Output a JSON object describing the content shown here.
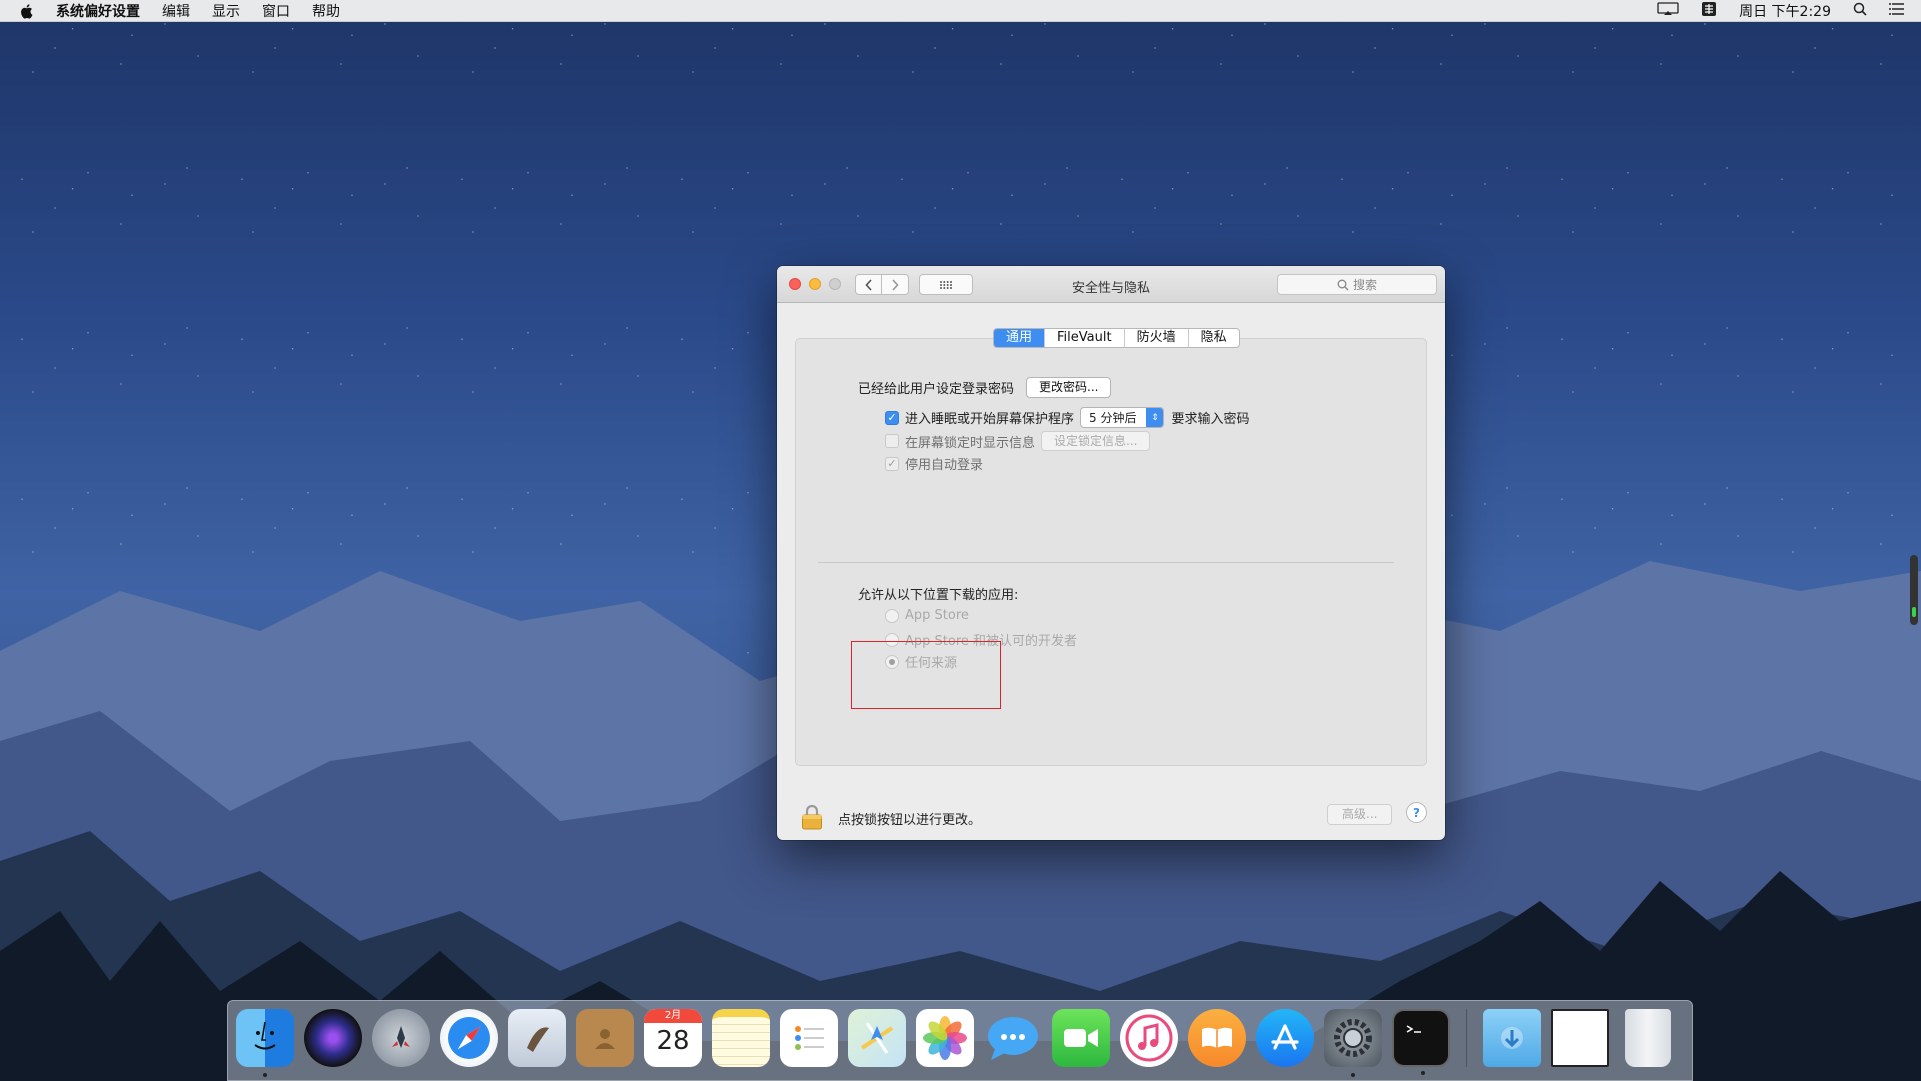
{
  "menubar": {
    "app_name": "系统偏好设置",
    "items": [
      "编辑",
      "显示",
      "窗口",
      "帮助"
    ],
    "clock": "周日 下午2:29"
  },
  "window": {
    "title": "安全性与隐私",
    "search_placeholder": "搜索",
    "tabs": [
      "通用",
      "FileVault",
      "防火墙",
      "隐私"
    ],
    "active_tab": "通用",
    "general": {
      "password_set_label": "已经给此用户设定登录密码",
      "change_password_button": "更改密码...",
      "require_password_prefix": "进入睡眠或开始屏幕保护程序",
      "require_password_delay": "5 分钟后",
      "require_password_suffix": "要求输入密码",
      "show_message_label": "在屏幕锁定时显示信息",
      "set_lock_message_button": "设定锁定信息...",
      "disable_auto_login_label": "停用自动登录",
      "allow_apps_heading": "允许从以下位置下载的应用:",
      "option_app_store": "App Store",
      "option_identified": "App Store 和被认可的开发者",
      "option_anywhere": "任何来源"
    },
    "footer": {
      "lock_text": "点按锁按钮以进行更改。",
      "advanced_button": "高级...",
      "help_button": "?"
    }
  },
  "dock": {
    "calendar_month": "2月",
    "calendar_day": "28"
  }
}
